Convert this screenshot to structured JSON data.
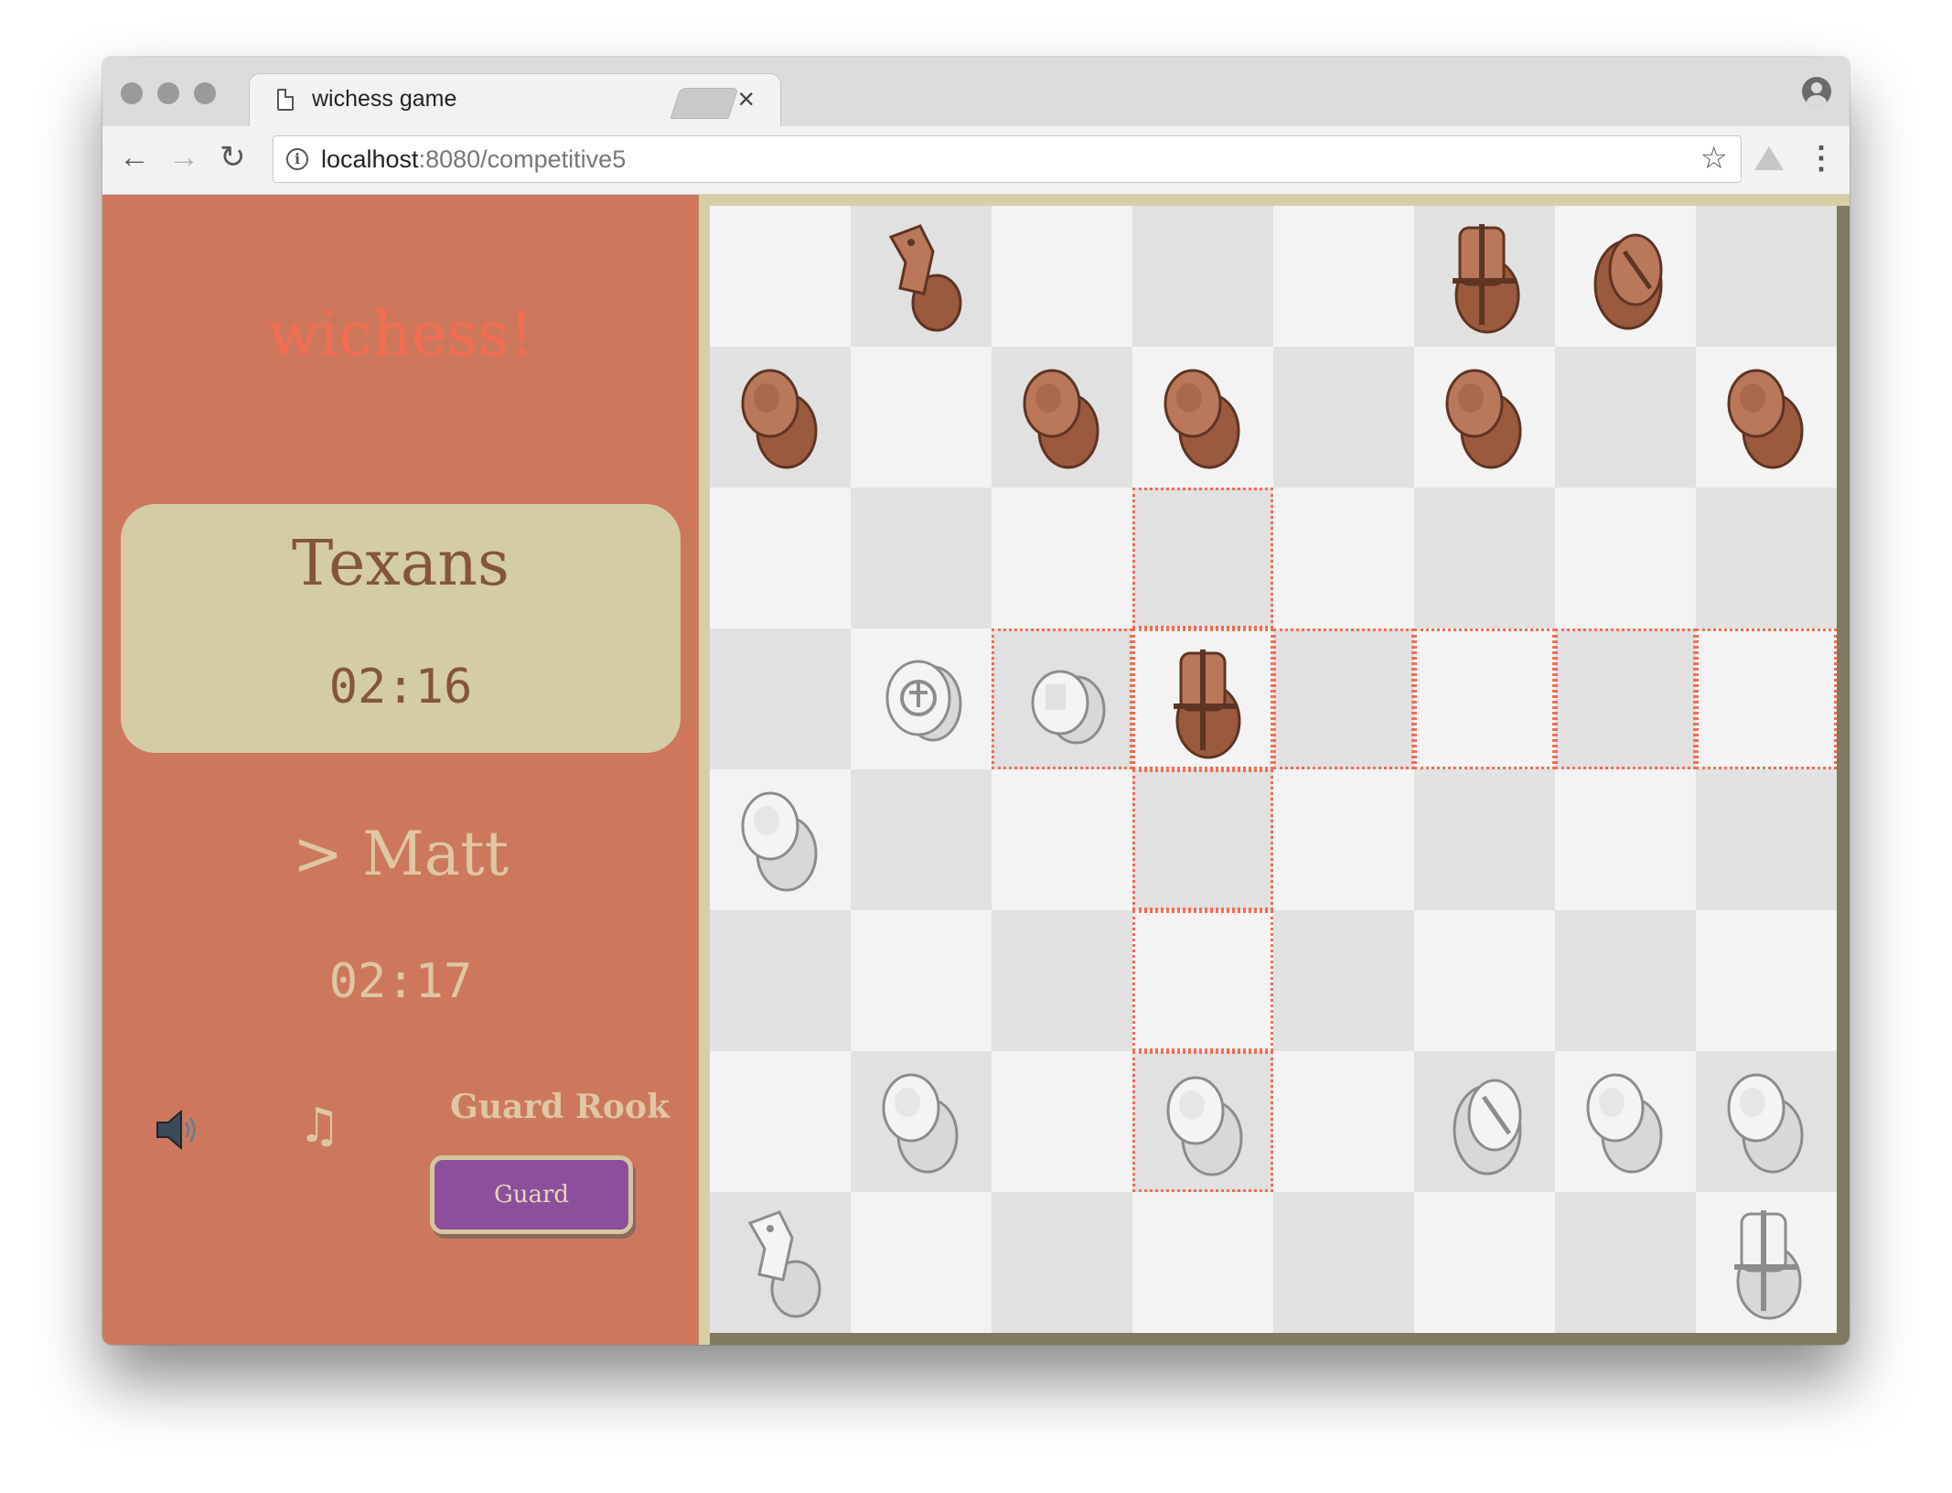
{
  "browser": {
    "tab_title": "wichess game",
    "tab_close": "×",
    "url_host": "localhost",
    "url_path": ":8080/competitive5",
    "back_icon": "←",
    "forward_icon": "→",
    "reload_icon": "↻",
    "info_icon": "i",
    "star_icon": "☆",
    "menu_icon": "⋮"
  },
  "sidebar": {
    "app_title": "wichess!",
    "opponent": {
      "name": "Texans",
      "clock": "02:16"
    },
    "player": {
      "name": "> Matt",
      "clock": "02:17"
    },
    "music_icon": "♫",
    "ability_label": "Guard Rook",
    "ability_button": "Guard"
  },
  "colors": {
    "sidebar_bg": "#cd785d",
    "title": "#f36d52",
    "card_bg": "#d4cca5",
    "button_bg": "#8b4f9c",
    "highlight": "#f36d52",
    "light_square": "#f3f3f3",
    "dark_square": "#e1e1e1",
    "black_piece": "#9a5a3e",
    "white_piece": "#d8d8d8"
  },
  "board": {
    "pieces": [
      {
        "row": 0,
        "col": 1,
        "color": "black",
        "kind": "knight"
      },
      {
        "row": 0,
        "col": 5,
        "color": "black",
        "kind": "rook"
      },
      {
        "row": 0,
        "col": 6,
        "color": "black",
        "kind": "bishop"
      },
      {
        "row": 1,
        "col": 0,
        "color": "black",
        "kind": "pawn"
      },
      {
        "row": 1,
        "col": 2,
        "color": "black",
        "kind": "pawn"
      },
      {
        "row": 1,
        "col": 3,
        "color": "black",
        "kind": "pawn"
      },
      {
        "row": 1,
        "col": 5,
        "color": "black",
        "kind": "pawn"
      },
      {
        "row": 1,
        "col": 7,
        "color": "black",
        "kind": "pawn"
      },
      {
        "row": 3,
        "col": 1,
        "color": "white",
        "kind": "king"
      },
      {
        "row": 3,
        "col": 2,
        "color": "white",
        "kind": "queen"
      },
      {
        "row": 3,
        "col": 3,
        "color": "black",
        "kind": "rook"
      },
      {
        "row": 4,
        "col": 0,
        "color": "white",
        "kind": "pawn"
      },
      {
        "row": 6,
        "col": 1,
        "color": "white",
        "kind": "pawn"
      },
      {
        "row": 6,
        "col": 3,
        "color": "white",
        "kind": "pawn"
      },
      {
        "row": 6,
        "col": 5,
        "color": "white",
        "kind": "bishop"
      },
      {
        "row": 6,
        "col": 6,
        "color": "white",
        "kind": "pawn"
      },
      {
        "row": 6,
        "col": 7,
        "color": "white",
        "kind": "pawn"
      },
      {
        "row": 7,
        "col": 0,
        "color": "white",
        "kind": "knight"
      },
      {
        "row": 7,
        "col": 7,
        "color": "white",
        "kind": "rook"
      }
    ],
    "highlighted": [
      {
        "row": 2,
        "col": 3
      },
      {
        "row": 3,
        "col": 2
      },
      {
        "row": 3,
        "col": 3
      },
      {
        "row": 3,
        "col": 4
      },
      {
        "row": 3,
        "col": 5
      },
      {
        "row": 3,
        "col": 6
      },
      {
        "row": 3,
        "col": 7
      },
      {
        "row": 4,
        "col": 3
      },
      {
        "row": 5,
        "col": 3
      },
      {
        "row": 6,
        "col": 3
      }
    ]
  }
}
